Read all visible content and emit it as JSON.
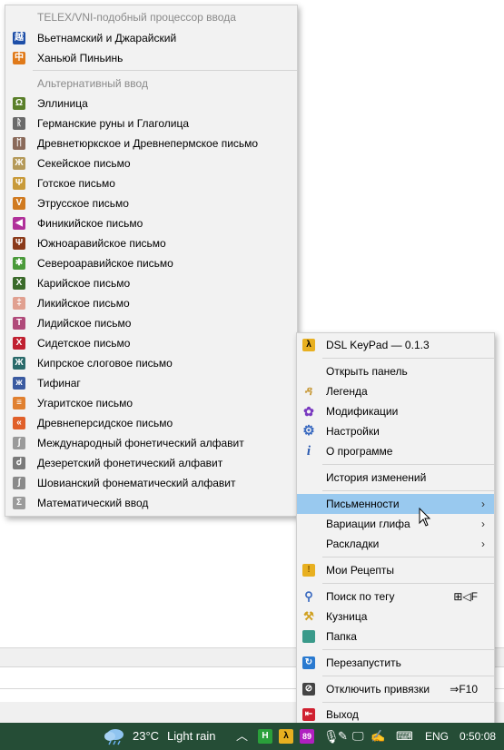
{
  "left_menu": {
    "section1_header": "TELEX/VNI-подобный процессор ввода",
    "section1_items": [
      {
        "label": "Вьетнамский и Джарайский",
        "icon": "viet-icon",
        "color": "#1e4fa8",
        "glyph": "越"
      },
      {
        "label": "Ханьюй Пиньинь",
        "icon": "pinyin-icon",
        "color": "#e07a1a",
        "glyph": "中"
      }
    ],
    "section2_header": "Альтернативный ввод",
    "section2_items": [
      {
        "label": "Эллиница",
        "icon": "greek-icon",
        "color": "#5a7f2a",
        "glyph": "Ω"
      },
      {
        "label": "Германские руны и Глаголица",
        "icon": "runes-icon",
        "color": "#6a6a6a",
        "glyph": "ᚱ"
      },
      {
        "label": "Древнетюркское и Древнепермское письмо",
        "icon": "old-turkic-icon",
        "color": "#8a6a5a",
        "glyph": "ᛖ"
      },
      {
        "label": "Секейское письмо",
        "icon": "szekely-icon",
        "color": "#b59a5a",
        "glyph": "Ж"
      },
      {
        "label": "Готское письмо",
        "icon": "gothic-icon",
        "color": "#c89a3a",
        "glyph": "Ψ"
      },
      {
        "label": "Этрусское письмо",
        "icon": "etruscan-icon",
        "color": "#d07a20",
        "glyph": "V"
      },
      {
        "label": "Финикийское письмо",
        "icon": "phoenician-icon",
        "color": "#b0309a",
        "glyph": "◀"
      },
      {
        "label": "Южноаравийское письмо",
        "icon": "south-arabian-icon",
        "color": "#8a3a1a",
        "glyph": "Ψ"
      },
      {
        "label": "Североаравийское письмо",
        "icon": "north-arabian-icon",
        "color": "#4a9a3a",
        "glyph": "✱"
      },
      {
        "label": "Карийское письмо",
        "icon": "carian-icon",
        "color": "#3a6a2a",
        "glyph": "X"
      },
      {
        "label": "Ликийское письмо",
        "icon": "lycian-icon",
        "color": "#e0a090",
        "glyph": "‡"
      },
      {
        "label": "Лидийское письмо",
        "icon": "lydian-icon",
        "color": "#b04a7a",
        "glyph": "T"
      },
      {
        "label": "Сидетское письмо",
        "icon": "sidetic-icon",
        "color": "#c02030",
        "glyph": "X"
      },
      {
        "label": "Кипрское слоговое письмо",
        "icon": "cypriot-icon",
        "color": "#2a6a6a",
        "glyph": "Ж"
      },
      {
        "label": "Тифинаг",
        "icon": "tifinagh-icon",
        "color": "#3a5aa0",
        "glyph": "ж"
      },
      {
        "label": "Угаритское письмо",
        "icon": "ugaritic-icon",
        "color": "#e08030",
        "glyph": "≡"
      },
      {
        "label": "Древнеперсидское письмо",
        "icon": "old-persian-icon",
        "color": "#e0602a",
        "glyph": "«"
      },
      {
        "label": "Международный фонетический алфавит",
        "icon": "ipa-icon",
        "color": "#9a9a9a",
        "glyph": "ʃ"
      },
      {
        "label": "Дезеретский фонетический алфавит",
        "icon": "deseret-icon",
        "color": "#7a7a7a",
        "glyph": "Ꮷ"
      },
      {
        "label": "Шовианский фонематический алфавит",
        "icon": "shavian-icon",
        "color": "#8a8a8a",
        "glyph": "ʃ"
      },
      {
        "label": "Математический ввод",
        "icon": "math-icon",
        "color": "#9a9a9a",
        "glyph": "Σ"
      }
    ]
  },
  "right_menu": {
    "title": "DSL KeyPad — 0.1.3",
    "items": {
      "open_panel": "Открыть панель",
      "legend": "Легенда",
      "modifications": "Модификации",
      "settings": "Настройки",
      "about": "О программе",
      "changelog": "История изменений",
      "scripts": "Письменности",
      "glyph_variations": "Вариации глифа",
      "layouts": "Раскладки",
      "my_recipes": "Мои Рецепты",
      "search_by_tag": "Поиск по тегу",
      "search_shortcut": "⊞◁F",
      "forge": "Кузница",
      "folder": "Папка",
      "restart": "Перезапустить",
      "disable_bindings": "Отключить привязки",
      "disable_shortcut": "⇒F10",
      "exit": "Выход"
    },
    "chevron": "›"
  },
  "taskbar": {
    "weather_temp": "23°C",
    "weather_text": "Light rain",
    "tray_badge": "89",
    "lang": "ENG",
    "time": "0:50:08"
  }
}
